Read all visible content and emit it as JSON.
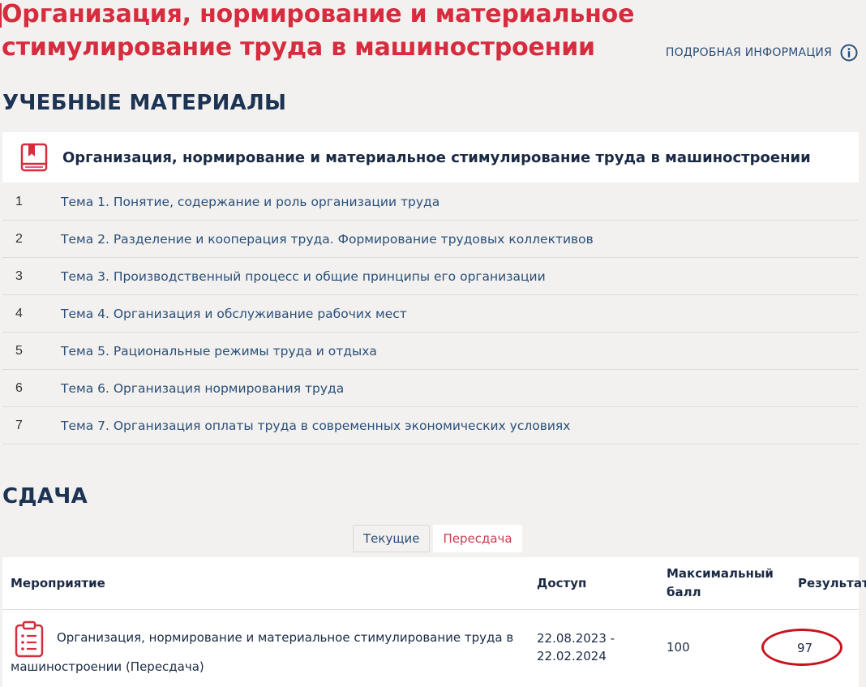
{
  "header": {
    "title": "Организация, нормирование и материальное стимулирование труда в машиностроении",
    "more_info_label": "ПОДРОБНАЯ ИНФОРМАЦИЯ",
    "more_info_icon": "info-icon"
  },
  "materials": {
    "section_title": "УЧЕБНЫЕ МАТЕРИАЛЫ",
    "card_icon": "book-icon",
    "card_title": "Организация, нормирование и материальное стимулирование труда в машиностроении",
    "topics": [
      {
        "num": "1",
        "label": "Тема 1. Понятие, содержание и роль организации труда"
      },
      {
        "num": "2",
        "label": "Тема 2. Разделение и кооперация труда. Формирование трудовых коллективов"
      },
      {
        "num": "3",
        "label": "Тема 3. Производственный процесс и общие принципы его организации"
      },
      {
        "num": "4",
        "label": "Тема 4. Организация и обслуживание рабочих мест"
      },
      {
        "num": "5",
        "label": "Тема 5. Рациональные режимы труда и отдыха"
      },
      {
        "num": "6",
        "label": "Тема 6. Организация нормирования труда"
      },
      {
        "num": "7",
        "label": "Тема 7. Организация оплаты труда в современных экономических условиях"
      }
    ]
  },
  "submission": {
    "section_title": "СДАЧА",
    "tabs": [
      {
        "label": "Текущие",
        "active": false
      },
      {
        "label": "Пересдача",
        "active": true
      }
    ],
    "table": {
      "headers": {
        "event": "Мероприятие",
        "access": "Доступ",
        "max_score_line1": "Максимальный",
        "max_score_line2": "балл",
        "result": "Результат"
      },
      "rows": [
        {
          "icon": "clipboard-icon",
          "event_line1": "Организация, нормирование и материальное стимулирование труда в",
          "event_line2": "машиностроении (Пересдача)",
          "access_from": "22.08.2023 -",
          "access_to": "22.02.2024",
          "max_score": "100",
          "result": "97"
        }
      ]
    }
  },
  "colors": {
    "title_red": "#d62c3e",
    "navy": "#1d3354",
    "link_blue": "#2a4f7a",
    "highlight_circle": "#c8141e",
    "background": "#f2f1ef"
  }
}
